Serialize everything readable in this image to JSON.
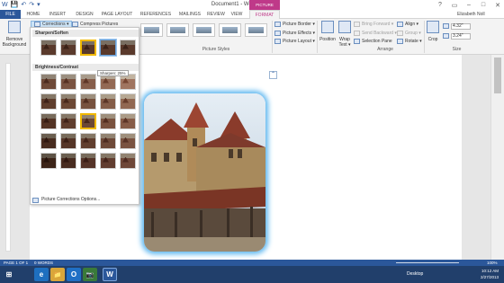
{
  "window": {
    "title": "Document1 - Word",
    "contextual_tab_group": "PICTURE TOOLS",
    "user": "Elizabeth Noll",
    "controls": [
      "?",
      "▭",
      "–",
      "□",
      "✕"
    ]
  },
  "qat": [
    "W",
    "💾",
    "↶",
    "↷",
    "▾"
  ],
  "tabs": [
    "FILE",
    "HOME",
    "INSERT",
    "DESIGN",
    "PAGE LAYOUT",
    "REFERENCES",
    "MAILINGS",
    "REVIEW",
    "VIEW",
    "FORMAT"
  ],
  "ribbon": {
    "remove_background": "Remove Background",
    "corrections": "Corrections ▾",
    "compress": "Compress Pictures",
    "picture_styles_label": "Picture Styles",
    "picture_border": "Picture Border ▾",
    "picture_effects": "Picture Effects ▾",
    "picture_layout": "Picture Layout ▾",
    "position": "Position",
    "wrap_text": "Wrap Text ▾",
    "bring_forward": "Bring Forward ▾",
    "send_backward": "Send Backward ▾",
    "selection_pane": "Selection Pane",
    "align": "Align ▾",
    "group": "Group ▾",
    "rotate": "Rotate ▾",
    "arrange_label": "Arrange",
    "crop": "Crop",
    "height": "4.32\"",
    "width": "3.24\"",
    "size_label": "Size"
  },
  "corrections_menu": {
    "sharpen_heading": "Sharpen/Soften",
    "brightness_heading": "Brightness/Contrast",
    "tooltip": "Sharpen: 25%",
    "footer": "Picture Corrections Options..."
  },
  "status": {
    "page": "PAGE 1 OF 1",
    "words": "0 WORDS",
    "zoom": "100%"
  },
  "taskbar": {
    "desktop": "Desktop",
    "time": "10:12 AM",
    "date": "2/27/2013",
    "apps": [
      "e",
      "📁",
      "O",
      "📷",
      "W"
    ]
  },
  "colors": {
    "accent": "#2b579a",
    "format_tab": "#bf3989",
    "selection": "#5fb8f0"
  }
}
